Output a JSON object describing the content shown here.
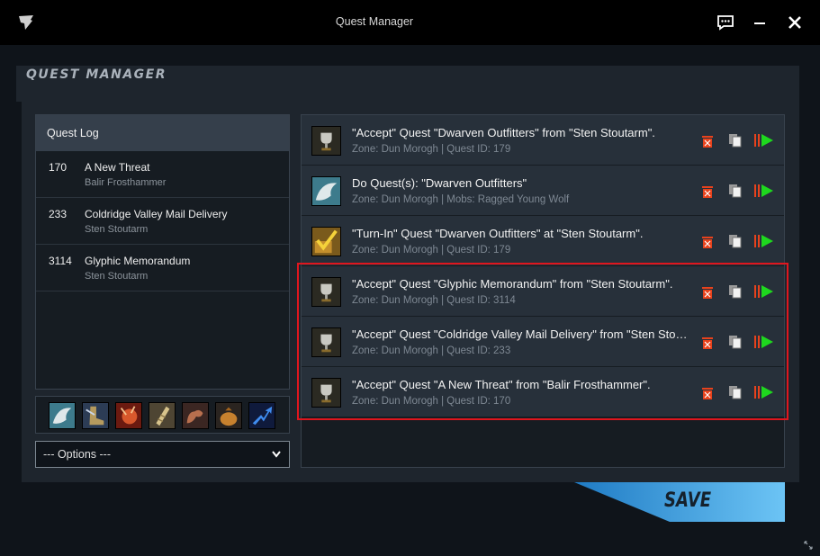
{
  "window": {
    "title": "Quest Manager",
    "icons": [
      "app-logo-icon",
      "chat-icon",
      "minimize-icon",
      "close-icon"
    ]
  },
  "heading": "QUEST MANAGER",
  "quest_log": {
    "header": "Quest Log",
    "items": [
      {
        "id": "170",
        "title": "A New Threat",
        "giver": "Balir Frosthammer"
      },
      {
        "id": "233",
        "title": "Coldridge Valley Mail Delivery",
        "giver": "Sten Stoutarm"
      },
      {
        "id": "3114",
        "title": "Glyphic Memorandum",
        "giver": "Sten Stoutarm"
      }
    ]
  },
  "skill_icons": [
    "grab-hand-icon",
    "boot-icon",
    "fire-fist-icon",
    "scroll-icon",
    "flex-arm-icon",
    "loot-bag-icon",
    "blue-arrow-icon"
  ],
  "options": {
    "selected": "--- Options ---"
  },
  "steps": [
    {
      "icon": "trophy-icon",
      "title": "\"Accept\" Quest \"Dwarven Outfitters\" from \"Sten Stoutarm\".",
      "meta": "Zone: Dun Morogh | Quest ID: 179"
    },
    {
      "icon": "grab-hand-icon",
      "title": "Do Quest(s): \"Dwarven Outfitters\"",
      "meta": "Zone: Dun Morogh | Mobs: Ragged Young Wolf"
    },
    {
      "icon": "checkmark-icon",
      "title": "\"Turn-In\" Quest \"Dwarven Outfitters\" at \"Sten Stoutarm\".",
      "meta": "Zone: Dun Morogh | Quest ID: 179"
    },
    {
      "icon": "trophy-icon",
      "title": "\"Accept\" Quest \"Glyphic Memorandum\" from \"Sten Stoutarm\".",
      "meta": "Zone: Dun Morogh | Quest ID: 3114"
    },
    {
      "icon": "trophy-icon",
      "title": "\"Accept\" Quest \"Coldridge Valley Mail Delivery\" from \"Sten Stoutarm\".",
      "meta": "Zone: Dun Morogh | Quest ID: 233"
    },
    {
      "icon": "trophy-icon",
      "title": "\"Accept\" Quest \"A New Threat\" from \"Balir Frosthammer\".",
      "meta": "Zone: Dun Morogh | Quest ID: 170"
    }
  ],
  "save_label": "SAVE",
  "colors": {
    "accent": "#3aa3e6",
    "delete": "#e8421c",
    "play": "#1ed81e",
    "highlight": "#e0161e"
  }
}
